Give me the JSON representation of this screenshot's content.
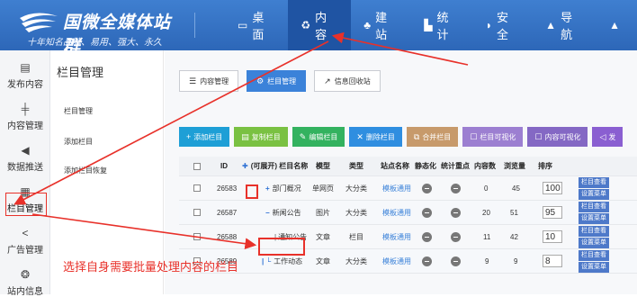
{
  "header": {
    "title": "国微全媒体站群",
    "subtitle": "十年知名品牌、易用、强大、永久",
    "nav": [
      {
        "label": "桌面",
        "icon": "desktop-icon",
        "active": false
      },
      {
        "label": "内容",
        "icon": "recycle-icon",
        "active": true
      },
      {
        "label": "建站",
        "icon": "tree-icon",
        "active": false
      },
      {
        "label": "统计",
        "icon": "chart-icon",
        "active": false
      },
      {
        "label": "安全",
        "icon": "shield-icon",
        "active": false
      },
      {
        "label": "导航",
        "icon": "nav-icon",
        "active": false
      }
    ]
  },
  "sidebar": {
    "items": [
      {
        "label": "发布内容",
        "icon": "publish-icon"
      },
      {
        "label": "内容管理",
        "icon": "content-icon"
      },
      {
        "label": "数据推送",
        "icon": "push-icon"
      },
      {
        "label": "栏目管理",
        "icon": "column-icon"
      },
      {
        "label": "广告管理",
        "icon": "ad-icon"
      },
      {
        "label": "站内信息",
        "icon": "message-icon"
      }
    ]
  },
  "subnav": {
    "title": "栏目管理",
    "items": [
      "栏目管理",
      "添加栏目",
      "添加栏目恢复"
    ]
  },
  "tabs": [
    "内容管理",
    "栏目管理",
    "信息回收站"
  ],
  "toolbar": [
    {
      "label": "添加栏目",
      "color": "#1e9fd6",
      "icon": "+"
    },
    {
      "label": "复制栏目",
      "color": "#7ac142",
      "icon": "▤"
    },
    {
      "label": "编辑栏目",
      "color": "#33b25f",
      "icon": "✎"
    },
    {
      "label": "删除栏目",
      "color": "#2f8ee0",
      "icon": "✕"
    },
    {
      "label": "合并栏目",
      "color": "#c79a6b",
      "icon": "⧉"
    },
    {
      "label": "栏目可视化",
      "color": "#9c7fd1",
      "icon": "☐"
    },
    {
      "label": "内容可视化",
      "color": "#8468c4",
      "icon": "☐"
    },
    {
      "label": "发",
      "color": "#8a5fd1",
      "icon": "◁"
    }
  ],
  "table": {
    "headers": [
      "ID",
      "(可展开) 栏目名称",
      "模型",
      "类型",
      "站点名称",
      "静态化",
      "统计重点",
      "内容数",
      "浏览量",
      "排序"
    ],
    "rows": [
      {
        "id": "26583",
        "prefix": "+",
        "name": "部门概况",
        "model": "单网页",
        "type": "大分类",
        "site": "模板通用",
        "count": "0",
        "views": "45",
        "sort": "100"
      },
      {
        "id": "26587",
        "prefix": "−",
        "name": "新闻公告",
        "model": "图片",
        "type": "大分类",
        "site": "模板通用",
        "count": "20",
        "views": "51",
        "sort": "95"
      },
      {
        "id": "26588",
        "prefix": "|",
        "name": "通知公告",
        "model": "文章",
        "type": "栏目",
        "site": "模板通用",
        "count": "11",
        "views": "42",
        "sort": "10"
      },
      {
        "id": "26589",
        "prefix": "| └",
        "name": "工作动态",
        "model": "文章",
        "type": "大分类",
        "site": "模板通用",
        "count": "9",
        "views": "9",
        "sort": "8"
      }
    ],
    "ops": [
      "栏目查看",
      "设置菜单"
    ]
  },
  "annotation": "选择自身需要批量处理内容的栏目"
}
